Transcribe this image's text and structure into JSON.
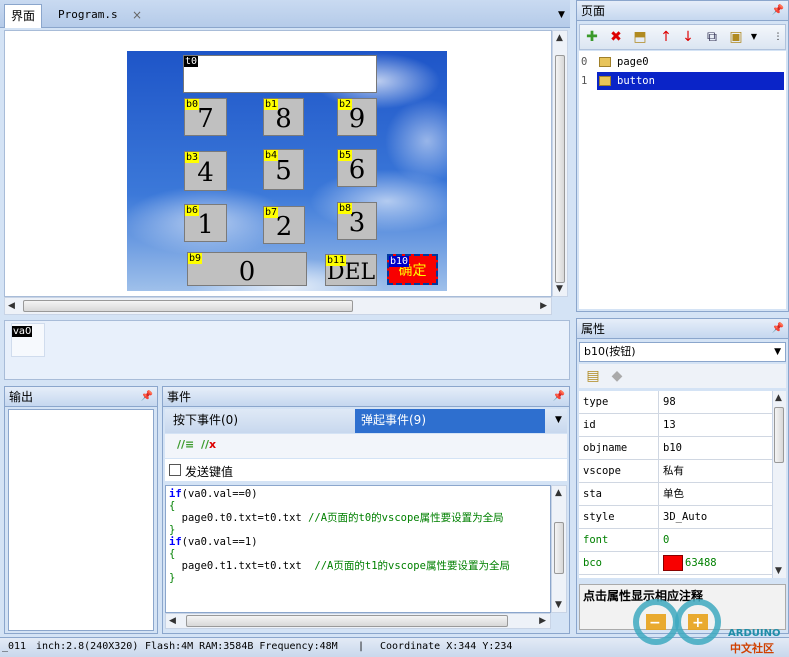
{
  "tabs": [
    {
      "label": "界面"
    },
    {
      "label": "Program.s"
    }
  ],
  "hmi": {
    "text_box": {
      "tag": "t0"
    },
    "keys": [
      {
        "tag": "b0",
        "label": "7"
      },
      {
        "tag": "b1",
        "label": "8"
      },
      {
        "tag": "b2",
        "label": "9"
      },
      {
        "tag": "b3",
        "label": "4"
      },
      {
        "tag": "b4",
        "label": "5"
      },
      {
        "tag": "b5",
        "label": "6"
      },
      {
        "tag": "b6",
        "label": "1"
      },
      {
        "tag": "b7",
        "label": "2"
      },
      {
        "tag": "b8",
        "label": "3"
      },
      {
        "tag": "b9",
        "label": "0"
      },
      {
        "tag": "b11",
        "label": "DEL"
      },
      {
        "tag": "b10",
        "label": "确定"
      }
    ]
  },
  "variables": [
    {
      "label": "va0"
    }
  ],
  "output_panel": {
    "title": "输出"
  },
  "event_panel": {
    "title": "事件",
    "tab_down": "按下事件(0)",
    "tab_up": "弹起事件(9)",
    "send_key_label": "发送键值",
    "code_lines": [
      [
        "kw",
        "if",
        "(va0.val==0)"
      ],
      [
        "br",
        "{",
        ""
      ],
      [
        "txt",
        "  page0.t0.txt=t0.txt ",
        "//A页面的t0的vscope属性要设置为全局"
      ],
      [
        "br",
        "}",
        ""
      ],
      [
        "kw",
        "if",
        "(va0.val==1)"
      ],
      [
        "br",
        "{",
        ""
      ],
      [
        "txt",
        "  page0.t1.txt=t0.txt  ",
        "//A页面的t1的vscope属性要设置为全局"
      ],
      [
        "br",
        "}",
        ""
      ]
    ]
  },
  "page_panel": {
    "title": "页面",
    "pages": [
      {
        "index": "0",
        "name": "page0",
        "selected": false
      },
      {
        "index": "1",
        "name": "button",
        "selected": true
      }
    ]
  },
  "prop_panel": {
    "title": "属性",
    "selected_object": "b10(按钮)",
    "rows": [
      {
        "name": "type",
        "value": "98",
        "green": false
      },
      {
        "name": "id",
        "value": "13",
        "green": false
      },
      {
        "name": "objname",
        "value": "b10",
        "green": false
      },
      {
        "name": "vscope",
        "value": "私有",
        "green": false
      },
      {
        "name": "sta",
        "value": "单色",
        "green": false
      },
      {
        "name": "style",
        "value": "3D_Auto",
        "green": false
      },
      {
        "name": "font",
        "value": "0",
        "green": true
      },
      {
        "name": "bco",
        "value": "63488",
        "green": true,
        "swatch": "#f80000"
      }
    ],
    "hint": "点击属性显示相应注释"
  },
  "status": {
    "device": "_011",
    "screen": "inch:2.8(240X320)",
    "memory": "Flash:4M RAM:3584B Frequency:48M",
    "coordinate": "Coordinate X:344  Y:234"
  },
  "watermark": {
    "text": "ARDUINO",
    "subtext": "中文社区"
  }
}
